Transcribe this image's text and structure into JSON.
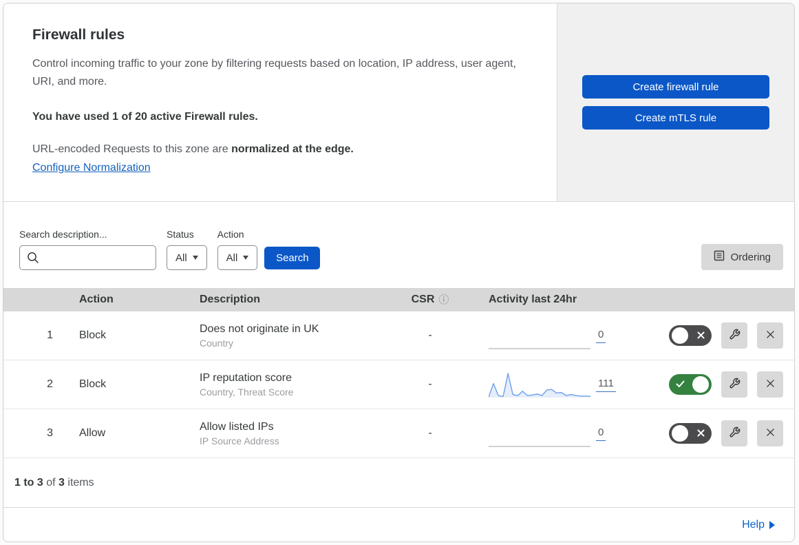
{
  "header": {
    "title": "Firewall rules",
    "description": "Control incoming traffic to your zone by filtering requests based on location, IP address, user agent, URI, and more.",
    "usage_notice": "You have used 1 of 20 active Firewall rules.",
    "normalization_prefix": "URL-encoded Requests to this zone are ",
    "normalization_bold": "normalized at the edge.",
    "normalization_link": "Configure Normalization",
    "create_firewall_button": "Create firewall rule",
    "create_mtls_button": "Create mTLS rule"
  },
  "filters": {
    "search_label": "Search description...",
    "search_value": "",
    "status_label": "Status",
    "status_value": "All",
    "action_label": "Action",
    "action_value": "All",
    "search_button": "Search",
    "ordering_button": "Ordering"
  },
  "table": {
    "columns": {
      "action": "Action",
      "description": "Description",
      "csr": "CSR",
      "info_icon": "ⓘ",
      "activity": "Activity last 24hr"
    },
    "rows": [
      {
        "number": "1",
        "action": "Block",
        "description": "Does not originate in UK",
        "fields": "Country",
        "csr": "-",
        "activity_count": "0",
        "activity_sparkline": [],
        "enabled": false
      },
      {
        "number": "2",
        "action": "Block",
        "description": "IP reputation score",
        "fields": "Country, Threat Score",
        "csr": "-",
        "activity_count": "111",
        "activity_sparkline": [
          2,
          55,
          8,
          4,
          95,
          12,
          8,
          25,
          8,
          10,
          14,
          8,
          30,
          32,
          18,
          20,
          8,
          12,
          8,
          6,
          6,
          5
        ],
        "enabled": true
      },
      {
        "number": "3",
        "action": "Allow",
        "description": "Allow listed IPs",
        "fields": "IP Source Address",
        "csr": "-",
        "activity_count": "0",
        "activity_sparkline": [],
        "enabled": false
      }
    ],
    "footer": {
      "range_bold": "1 to 3",
      "of_text": " of ",
      "total_bold": "3",
      "items_text": " items"
    }
  },
  "help_link": "Help",
  "colors": {
    "accent_blue": "#0b57c7",
    "link_blue": "#1561bd",
    "toggle_on_green": "#35813f",
    "toggle_off_gray": "#4b4b4d",
    "sparkline_blue": "#6d9fe8",
    "panel_gray": "#f0f0f1",
    "table_header_gray": "#d8d8d8",
    "button_gray": "#d9d9d9"
  }
}
